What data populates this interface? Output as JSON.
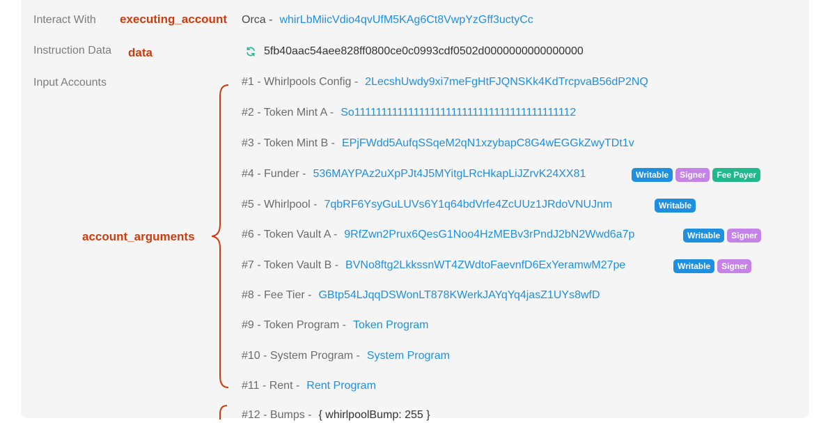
{
  "labels": {
    "interact_with": "Interact With",
    "instruction_data": "Instruction Data",
    "input_accounts": "Input Accounts"
  },
  "annotations": {
    "executing_account": "executing_account",
    "data": "data",
    "account_arguments": "account_arguments"
  },
  "interact": {
    "program_name": "Orca -",
    "address": "whirLbMiicVdio4qvUfM5KAg6Ct8VwpYzGff3uctyCc"
  },
  "instruction": {
    "icon": "refresh-icon",
    "hex": "5fb40aac54aee828ff0800ce0c0993cdf0502d0000000000000000"
  },
  "accounts": [
    {
      "prefix": "#1 - Whirlpools Config -",
      "address": "2LecshUwdy9xi7meFgHtFJQNSKk4KdTrcpvaB56dP2NQ",
      "badges": []
    },
    {
      "prefix": "#2 - Token Mint A -",
      "address": "So11111111111111111111111111111111111111112",
      "badges": []
    },
    {
      "prefix": "#3 - Token Mint B -",
      "address": "EPjFWdd5AufqSSqeM2qN1xzybapC8G4wEGGkZwyTDt1v",
      "badges": []
    },
    {
      "prefix": "#4 - Funder -",
      "address": "536MAYPAz2uXpPJt4J5MYitgLRcHkapLiJZrvK24XX81",
      "badges": [
        "Writable",
        "Signer",
        "Fee Payer"
      ]
    },
    {
      "prefix": "#5 - Whirlpool -",
      "address": "7qbRF6YsyGuLUVs6Y1q64bdVrfe4ZcUUz1JRdoVNUJnm",
      "badges": [
        "Writable"
      ]
    },
    {
      "prefix": "#6 - Token Vault A -",
      "address": "9RfZwn2Prux6QesG1Noo4HzMEBv3rPndJ2bN2Wwd6a7p",
      "badges": [
        "Writable",
        "Signer"
      ]
    },
    {
      "prefix": "#7 - Token Vault B -",
      "address": "BVNo8ftg2LkkssnWT4ZWdtoFaevnfD6ExYeramwM27pe",
      "badges": [
        "Writable",
        "Signer"
      ]
    },
    {
      "prefix": "#8 - Fee Tier -",
      "address": "GBtp54LJqqDSWonLT878KWerkJAYqYq4jasZ1UYs8wfD",
      "badges": []
    },
    {
      "prefix": "#9 - Token Program -",
      "address": "Token Program",
      "badges": []
    },
    {
      "prefix": "#10 - System Program -",
      "address": "System Program",
      "badges": []
    },
    {
      "prefix": "#11 - Rent -",
      "address": "Rent Program",
      "badges": []
    }
  ],
  "bumps": {
    "prefix": "#12 - Bumps -",
    "value": "{ whirlpoolBump: 255 }"
  },
  "colors": {
    "annotation": "#cf3b0c",
    "link": "#1f8fe0",
    "writable": "#1f8fe0",
    "signer": "#c583e8",
    "fee_payer": "#21b88e"
  }
}
